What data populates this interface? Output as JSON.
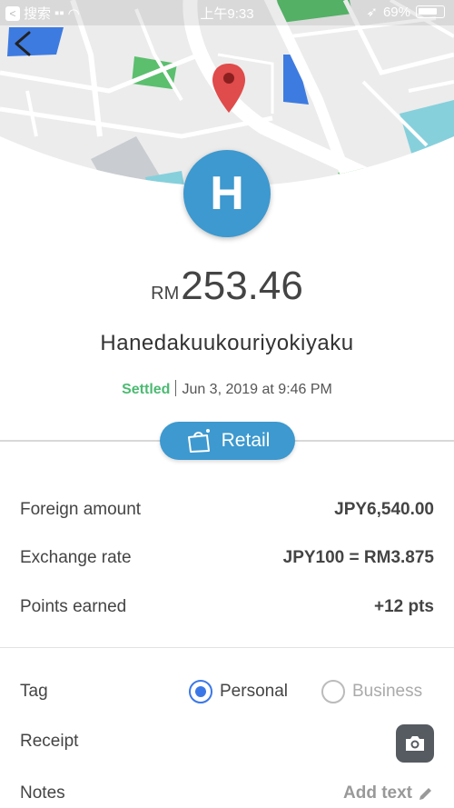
{
  "status_bar": {
    "back_app": "搜索",
    "time": "上午9:33",
    "battery": "69%"
  },
  "map": {
    "road_color": "#ffffff",
    "land_color": "#ececec",
    "park_color": "#5bbf6e",
    "water_color": "#3d7be0",
    "teal_color": "#86d0dc",
    "pin_color": "#e04b4b",
    "icons": [
      "back-arrow-icon",
      "map-pin-icon"
    ]
  },
  "merchant": {
    "initial": "H",
    "avatar_color": "#3d99cf",
    "currency": "RM",
    "amount": "253.46",
    "name": "Hanedakuukouriyokiyaku"
  },
  "transaction": {
    "status": "Settled",
    "status_color": "#4cba72",
    "datetime": "Jun 3, 2019 at 9:46 PM"
  },
  "category": {
    "label": "Retail",
    "icon": "shopping-bag-icon"
  },
  "details": [
    {
      "label": "Foreign amount",
      "value": "JPY6,540.00"
    },
    {
      "label": "Exchange rate",
      "value": "JPY100 = RM3.875"
    },
    {
      "label": "Points earned",
      "value": "+12 pts"
    }
  ],
  "tag": {
    "label": "Tag",
    "options": [
      "Personal",
      "Business"
    ],
    "selected": "Personal"
  },
  "receipt": {
    "label": "Receipt",
    "icon": "camera-icon"
  },
  "notes": {
    "label": "Notes",
    "action": "Add text",
    "icon": "pencil-icon"
  }
}
